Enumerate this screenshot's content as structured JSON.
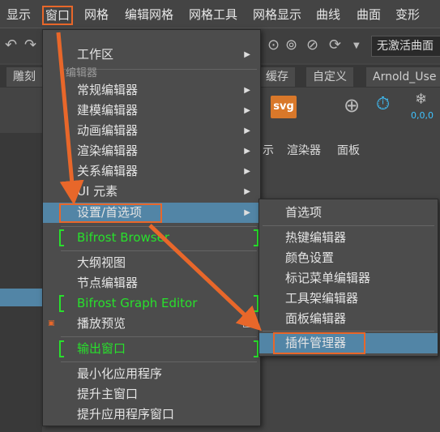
{
  "menubar": {
    "items": [
      "显示",
      "窗口",
      "网格",
      "编辑网格",
      "网格工具",
      "网格显示",
      "曲线",
      "曲面",
      "变形"
    ]
  },
  "toolbar": {
    "field_value": "无激活曲面"
  },
  "shelf_tabs": [
    "雕刻",
    "缓存",
    "自定义",
    "Arnold_Use"
  ],
  "shelf": {
    "svg_label": "svg",
    "coord_text": "0,0,0"
  },
  "panel_menu": [
    "示",
    "渲染器",
    "面板"
  ],
  "window_menu": {
    "section_label": "编辑器",
    "items": [
      {
        "label": "工作区",
        "submenu": true
      },
      {
        "label": "常规编辑器",
        "submenu": true
      },
      {
        "label": "建模编辑器",
        "submenu": true
      },
      {
        "label": "动画编辑器",
        "submenu": true
      },
      {
        "label": "渲染编辑器",
        "submenu": true
      },
      {
        "label": "关系编辑器",
        "submenu": true
      },
      {
        "label": "UI 元素",
        "submenu": true
      },
      {
        "label": "设置/首选项",
        "submenu": true
      },
      {
        "label": "Bifrost Browser"
      },
      {
        "label": "大纲视图"
      },
      {
        "label": "节点编辑器"
      },
      {
        "label": "Bifrost Graph Editor"
      },
      {
        "label": "播放预览"
      },
      {
        "label": "输出窗口"
      },
      {
        "label": "最小化应用程序"
      },
      {
        "label": "提升主窗口"
      },
      {
        "label": "提升应用程序窗口"
      }
    ]
  },
  "prefs_submenu": {
    "items": [
      "首选项",
      "热键编辑器",
      "颜色设置",
      "标记菜单编辑器",
      "工具架编辑器",
      "面板编辑器",
      "插件管理器"
    ]
  },
  "colors": {
    "highlight": "#5285a6",
    "annotation": "#e8672a",
    "green_bracket": "#28e02c"
  }
}
